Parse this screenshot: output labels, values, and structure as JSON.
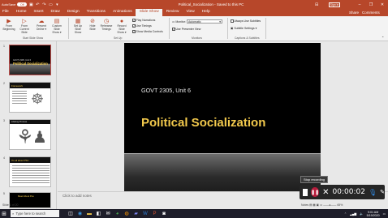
{
  "titlebar": {
    "autosave_label": "AutoSave",
    "autosave_state": "Off",
    "document_title": "Political_Socialization  -  Saved to this PC",
    "signin_label": "Sign in",
    "minimize": "–",
    "restore": "❐",
    "close": "✕",
    "ribbon_display": "⊟"
  },
  "menu": {
    "tabs": [
      {
        "label": "File"
      },
      {
        "label": "Home"
      },
      {
        "label": "Insert"
      },
      {
        "label": "Draw"
      },
      {
        "label": "Design"
      },
      {
        "label": "Transitions"
      },
      {
        "label": "Animations"
      },
      {
        "label": "Slide Show"
      },
      {
        "label": "Review"
      },
      {
        "label": "View"
      },
      {
        "label": "Help"
      }
    ],
    "active_tab": "Slide Show",
    "share_label": "Share",
    "comments_label": "Comments"
  },
  "ribbon": {
    "start_group": {
      "from_beginning": "From\nBeginning",
      "from_current": "From\nCurrent Slide",
      "present_online": "Present\nOnline ▾",
      "custom_show": "Custom Slide\nShow ▾",
      "label": "Start Slide Show"
    },
    "setup_group": {
      "setup_show": "Set Up\nSlide Show",
      "hide_slide": "Hide\nSlide",
      "rehearse": "Rehearse\nTimings",
      "record": "Record Slide\nShow ▾",
      "play_narrations": "Play Narrations",
      "use_timings": "Use Timings",
      "show_media_controls": "Show Media Controls",
      "label": "Set Up"
    },
    "monitors_group": {
      "monitor_label": "Monitor:",
      "monitor_value": "Automatic",
      "presenter_view": "Use Presenter View",
      "label": "Monitors"
    },
    "captions_group": {
      "always_subtitles": "Always Use Subtitles",
      "subtitle_settings": "Subtitle Settings ▾",
      "label": "Captions & Subtitles"
    }
  },
  "thumbnails": {
    "numbers": [
      "1",
      "2",
      "3",
      "4",
      "5"
    ],
    "slide1_subtitle": "GOVT 2305, Unit 6",
    "slide1_title": "Political Socialization",
    "slide2_header": "Framework",
    "slide3_header": "Lifelong Process",
    "slide4_header": "It's all about PSU",
    "slide5_header": "Meet About Psu"
  },
  "slide": {
    "subtitle": "GOVT 2305, Unit 6",
    "title": "Political Socialization"
  },
  "notes_placeholder": "Click to add notes",
  "recording": {
    "tooltip": "Stop recording",
    "time": "00:00:02"
  },
  "status": {
    "slide_count": "Slide 1 of 20",
    "zoom": "Notes  ▤  ▦  ▣  ▭ ——●—— 65%"
  },
  "taskbar": {
    "search_placeholder": "Type here to search",
    "time": "9:01 AM",
    "date": "5/19/2020"
  }
}
